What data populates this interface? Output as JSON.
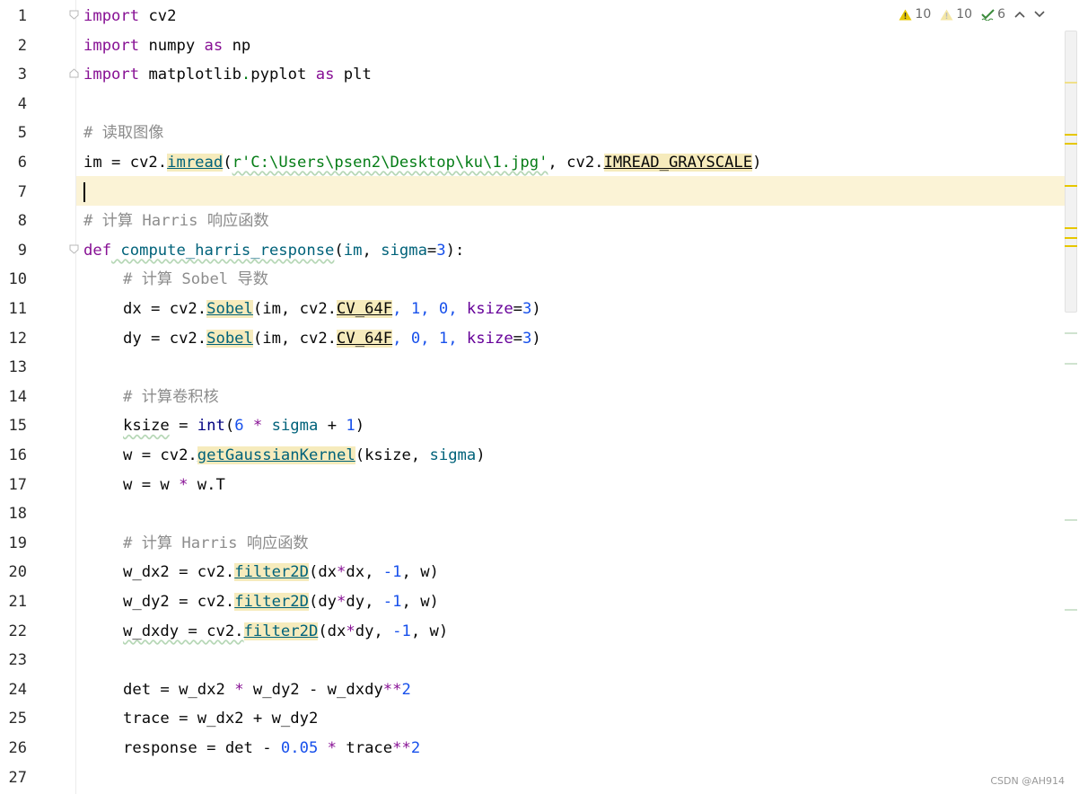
{
  "editor": {
    "lines": [
      {
        "n": "1"
      },
      {
        "n": "2"
      },
      {
        "n": "3"
      },
      {
        "n": "4"
      },
      {
        "n": "5"
      },
      {
        "n": "6"
      },
      {
        "n": "7"
      },
      {
        "n": "8"
      },
      {
        "n": "9"
      },
      {
        "n": "10"
      },
      {
        "n": "11"
      },
      {
        "n": "12"
      },
      {
        "n": "13"
      },
      {
        "n": "14"
      },
      {
        "n": "15"
      },
      {
        "n": "16"
      },
      {
        "n": "17"
      },
      {
        "n": "18"
      },
      {
        "n": "19"
      },
      {
        "n": "20"
      },
      {
        "n": "21"
      },
      {
        "n": "22"
      },
      {
        "n": "23"
      },
      {
        "n": "24"
      },
      {
        "n": "25"
      },
      {
        "n": "26"
      },
      {
        "n": "27"
      }
    ],
    "code": {
      "l1": {
        "kw": "import",
        "rest": " cv2"
      },
      "l2": {
        "kw": "import",
        "mid": " numpy ",
        "as": "as",
        "rest": " np"
      },
      "l3": {
        "kw": "import",
        "mid": " matplotlib",
        "dot": ".",
        "mod": "pyplot ",
        "as": "as",
        "rest": " plt"
      },
      "l5": {
        "cmt": "# 读取图像"
      },
      "l6": {
        "a": "im = cv2.",
        "fn": "imread",
        "p1": "(",
        "str": "r'C:\\Users\\psen2\\Desktop\\ku\\1.jpg'",
        "p2": ", cv2.",
        "const": "IMREAD_GRAYSCALE",
        "p3": ")"
      },
      "l8": {
        "cmt": "# 计算 Harris 响应函数"
      },
      "l9": {
        "kw": "def",
        "fn": " compute_harris_response",
        "p1": "(",
        "a1": "im",
        "c1": ", ",
        "a2": "sigma",
        "eq": "=",
        "num": "3",
        "p2": "):"
      },
      "l10": {
        "cmt": "# 计算 Sobel 导数"
      },
      "l11": {
        "a": "dx = cv2.",
        "fn": "Sobel",
        "p1": "(im, cv2.",
        "const": "CV_64F",
        "n1": ", 1, 0, ",
        "kw": "ksize",
        "eq": "=",
        "num": "3",
        "p2": ")"
      },
      "l12": {
        "a": "dy = cv2.",
        "fn": "Sobel",
        "p1": "(im, cv2.",
        "const": "CV_64F",
        "n1": ", 0, 1, ",
        "kw": "ksize",
        "eq": "=",
        "num": "3",
        "p2": ")"
      },
      "l14": {
        "cmt": "# 计算卷积核"
      },
      "l15": {
        "a": "ksize",
        "b": " = ",
        "bi": "int",
        "p1": "(",
        "n1": "6",
        "op": " * ",
        "v": "sigma",
        "op2": " + ",
        "n2": "1",
        "p2": ")"
      },
      "l16": {
        "a": "w = cv2.",
        "fn": "getGaussianKernel",
        "p1": "(ksize, ",
        "v": "sigma",
        "p2": ")"
      },
      "l17": {
        "a": "w = w ",
        "op": "*",
        "b": " w.T"
      },
      "l19": {
        "cmt": "# 计算 Harris 响应函数"
      },
      "l20": {
        "a": "w_dx2 = cv2.",
        "fn": "filter2D",
        "p1": "(dx",
        "op": "*",
        "b": "dx, ",
        "n": "-1",
        "c": ", w)"
      },
      "l21": {
        "a": "w_dy2 = cv2.",
        "fn": "filter2D",
        "p1": "(dy",
        "op": "*",
        "b": "dy, ",
        "n": "-1",
        "c": ", w)"
      },
      "l22": {
        "a": "w_dxdy = cv2.",
        "fn": "filter2D",
        "p1": "(dx",
        "op": "*",
        "b": "dy, ",
        "n": "-1",
        "c": ", w)"
      },
      "l24": {
        "a": "det = w_dx2 ",
        "op": "*",
        "b": " w_dy2 - w_dxdy",
        "op2": "**",
        "n": "2"
      },
      "l25": {
        "a": "trace = w_dx2 + w_dy2"
      },
      "l26": {
        "a": "response = det - ",
        "n1": "0.05",
        "op": " * ",
        "b": "trace",
        "op2": "**",
        "n2": "2"
      }
    }
  },
  "inspections": {
    "warnings": "10",
    "weak_warnings": "10",
    "typos": "6",
    "warning_color": "#e6c700",
    "weak_color": "#f0e08a",
    "typo_color": "#3a8a3a"
  },
  "watermark": "CSDN @AH914"
}
